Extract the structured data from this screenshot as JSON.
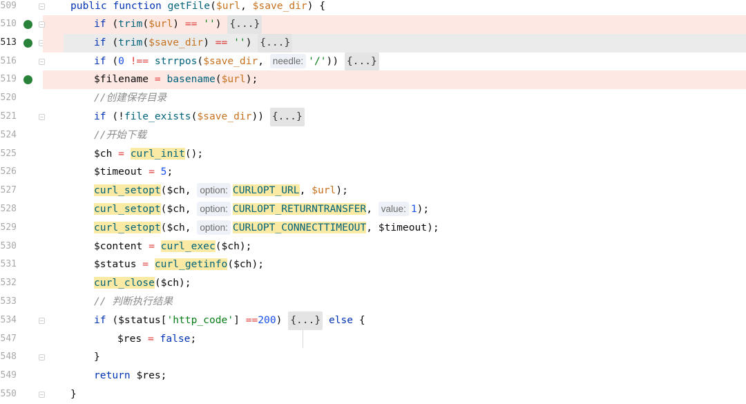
{
  "editor": {
    "lines": [
      {
        "num": "509",
        "text": "public function getFile($url, $save_dir) {"
      },
      {
        "num": "510",
        "text": "if (trim($url) == '') {...}",
        "breakpoint": true
      },
      {
        "num": "513",
        "text": "if (trim($save_dir) == '') {...}",
        "breakpoint": true,
        "current": true
      },
      {
        "num": "516",
        "text": "if (0 !== strrpos($save_dir, needle: '/')) {...}"
      },
      {
        "num": "519",
        "text": "$filename = basename($url);",
        "breakpoint": true
      },
      {
        "num": "520",
        "text": "//创建保存目录"
      },
      {
        "num": "521",
        "text": "if (!file_exists($save_dir)) {...}"
      },
      {
        "num": "524",
        "text": "//开始下载"
      },
      {
        "num": "525",
        "text": "$ch = curl_init();"
      },
      {
        "num": "526",
        "text": "$timeout = 5;"
      },
      {
        "num": "527",
        "text": "curl_setopt($ch, option: CURLOPT_URL, $url);"
      },
      {
        "num": "528",
        "text": "curl_setopt($ch, option: CURLOPT_RETURNTRANSFER, value: 1);"
      },
      {
        "num": "529",
        "text": "curl_setopt($ch, option: CURLOPT_CONNECTTIMEOUT, $timeout);"
      },
      {
        "num": "530",
        "text": "$content = curl_exec($ch);"
      },
      {
        "num": "531",
        "text": "$status = curl_getinfo($ch);"
      },
      {
        "num": "532",
        "text": "curl_close($ch);"
      },
      {
        "num": "533",
        "text": "// 判断执行结果"
      },
      {
        "num": "534",
        "text": "if ($status['http_code'] ==200) {...} else {"
      },
      {
        "num": "547",
        "text": "$res = false;"
      },
      {
        "num": "548",
        "text": "}"
      },
      {
        "num": "549",
        "text": "return $res;"
      },
      {
        "num": "550",
        "text": "}"
      }
    ]
  }
}
